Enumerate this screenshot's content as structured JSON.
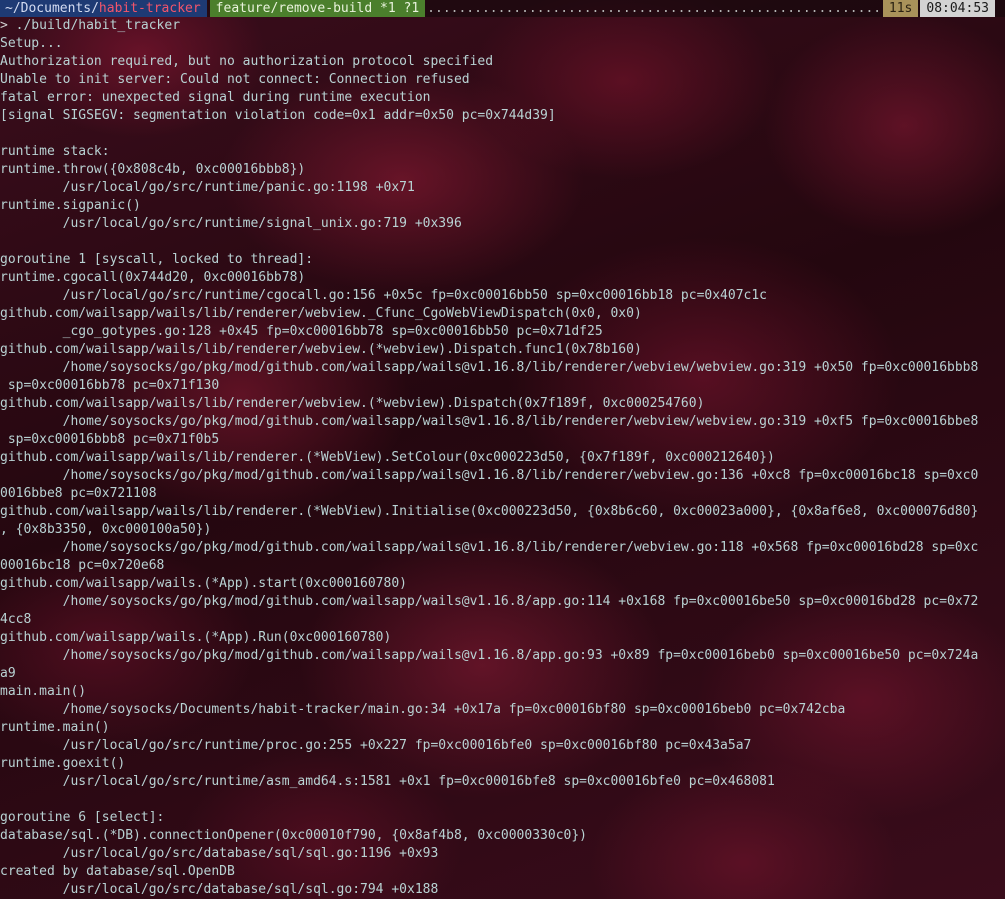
{
  "statusbar": {
    "path_prefix": "~/Documents/",
    "path_repo": "habit-tracker",
    "git_status": "feature/remove-build *1 ?1",
    "fill_dots": "..........................................................................................................",
    "duration": "11s",
    "time": "08:04:53"
  },
  "prompt": {
    "symbol": ">",
    "command": "./build/habit_tracker"
  },
  "output_lines": [
    "Setup...",
    "Authorization required, but no authorization protocol specified",
    "Unable to init server: Could not connect: Connection refused",
    "fatal error: unexpected signal during runtime execution",
    "[signal SIGSEGV: segmentation violation code=0x1 addr=0x50 pc=0x744d39]",
    "",
    "runtime stack:",
    "runtime.throw({0x808c4b, 0xc00016bbb8})",
    "        /usr/local/go/src/runtime/panic.go:1198 +0x71",
    "runtime.sigpanic()",
    "        /usr/local/go/src/runtime/signal_unix.go:719 +0x396",
    "",
    "goroutine 1 [syscall, locked to thread]:",
    "runtime.cgocall(0x744d20, 0xc00016bb78)",
    "        /usr/local/go/src/runtime/cgocall.go:156 +0x5c fp=0xc00016bb50 sp=0xc00016bb18 pc=0x407c1c",
    "github.com/wailsapp/wails/lib/renderer/webview._Cfunc_CgoWebViewDispatch(0x0, 0x0)",
    "        _cgo_gotypes.go:128 +0x45 fp=0xc00016bb78 sp=0xc00016bb50 pc=0x71df25",
    "github.com/wailsapp/wails/lib/renderer/webview.(*webview).Dispatch.func1(0x78b160)",
    "        /home/soysocks/go/pkg/mod/github.com/wailsapp/wails@v1.16.8/lib/renderer/webview/webview.go:319 +0x50 fp=0xc00016bbb8",
    " sp=0xc00016bb78 pc=0x71f130",
    "github.com/wailsapp/wails/lib/renderer/webview.(*webview).Dispatch(0x7f189f, 0xc000254760)",
    "        /home/soysocks/go/pkg/mod/github.com/wailsapp/wails@v1.16.8/lib/renderer/webview/webview.go:319 +0xf5 fp=0xc00016bbe8",
    " sp=0xc00016bbb8 pc=0x71f0b5",
    "github.com/wailsapp/wails/lib/renderer.(*WebView).SetColour(0xc000223d50, {0x7f189f, 0xc000212640})",
    "        /home/soysocks/go/pkg/mod/github.com/wailsapp/wails@v1.16.8/lib/renderer/webview.go:136 +0xc8 fp=0xc00016bc18 sp=0xc0",
    "0016bbe8 pc=0x721108",
    "github.com/wailsapp/wails/lib/renderer.(*WebView).Initialise(0xc000223d50, {0x8b6c60, 0xc00023a000}, {0x8af6e8, 0xc000076d80}",
    ", {0x8b3350, 0xc000100a50})",
    "        /home/soysocks/go/pkg/mod/github.com/wailsapp/wails@v1.16.8/lib/renderer/webview.go:118 +0x568 fp=0xc00016bd28 sp=0xc",
    "00016bc18 pc=0x720e68",
    "github.com/wailsapp/wails.(*App).start(0xc000160780)",
    "        /home/soysocks/go/pkg/mod/github.com/wailsapp/wails@v1.16.8/app.go:114 +0x168 fp=0xc00016be50 sp=0xc00016bd28 pc=0x72",
    "4cc8",
    "github.com/wailsapp/wails.(*App).Run(0xc000160780)",
    "        /home/soysocks/go/pkg/mod/github.com/wailsapp/wails@v1.16.8/app.go:93 +0x89 fp=0xc00016beb0 sp=0xc00016be50 pc=0x724a",
    "a9",
    "main.main()",
    "        /home/soysocks/Documents/habit-tracker/main.go:34 +0x17a fp=0xc00016bf80 sp=0xc00016beb0 pc=0x742cba",
    "runtime.main()",
    "        /usr/local/go/src/runtime/proc.go:255 +0x227 fp=0xc00016bfe0 sp=0xc00016bf80 pc=0x43a5a7",
    "runtime.goexit()",
    "        /usr/local/go/src/runtime/asm_amd64.s:1581 +0x1 fp=0xc00016bfe8 sp=0xc00016bfe0 pc=0x468081",
    "",
    "goroutine 6 [select]:",
    "database/sql.(*DB).connectionOpener(0xc00010f790, {0x8af4b8, 0xc0000330c0})",
    "        /usr/local/go/src/database/sql/sql.go:1196 +0x93",
    "created by database/sql.OpenDB",
    "        /usr/local/go/src/database/sql/sql.go:794 +0x188"
  ]
}
